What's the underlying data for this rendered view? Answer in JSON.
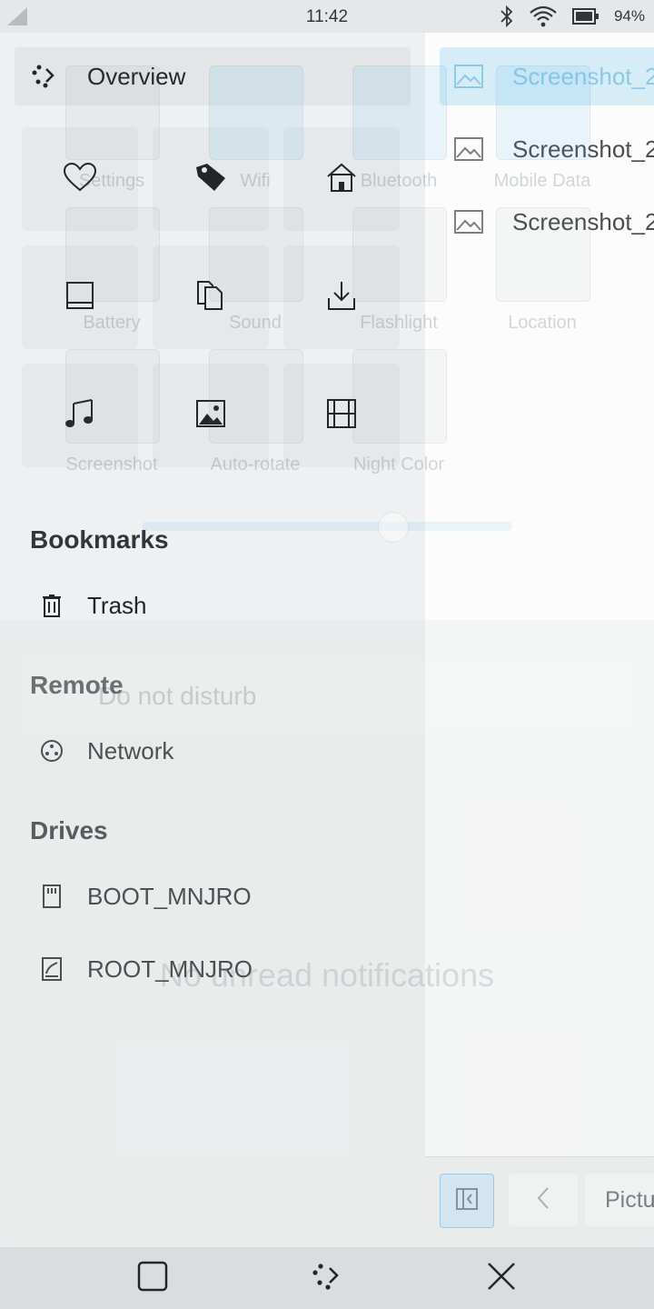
{
  "status_bar": {
    "time": "11:42",
    "battery_percent": "94%"
  },
  "places": {
    "overview": {
      "label": "Overview",
      "icon": "overview-icon"
    },
    "quick_grid": [
      {
        "name": "favorites-icon"
      },
      {
        "name": "tag-icon"
      },
      {
        "name": "home-icon"
      },
      {
        "name": "desktop-icon"
      },
      {
        "name": "documents-icon"
      },
      {
        "name": "downloads-icon"
      },
      {
        "name": "music-icon"
      },
      {
        "name": "pictures-icon"
      },
      {
        "name": "videos-icon"
      }
    ],
    "sections": {
      "bookmarks": {
        "title": "Bookmarks",
        "items": [
          {
            "label": "Trash",
            "icon": "trash-icon"
          }
        ]
      },
      "remote": {
        "title": "Remote",
        "items": [
          {
            "label": "Network",
            "icon": "network-icon"
          }
        ]
      },
      "drives": {
        "title": "Drives",
        "items": [
          {
            "label": "BOOT_MNJRO",
            "icon": "sd-card-icon"
          },
          {
            "label": "ROOT_MNJRO",
            "icon": "drive-icon"
          }
        ]
      }
    }
  },
  "files": {
    "items": [
      {
        "name": "Screenshot_2",
        "selected": true
      },
      {
        "name": "Screenshot_2",
        "selected": false
      },
      {
        "name": "Screenshot_2",
        "selected": false
      }
    ],
    "breadcrumb": "Pictu"
  },
  "ghost_quick_settings": {
    "tiles": [
      "Settings",
      "Wifi",
      "Bluetooth",
      "Mobile Data",
      "Battery",
      "Sound",
      "Flashlight",
      "Location",
      "Screenshot",
      "Auto-rotate",
      "Night Color"
    ],
    "do_not_disturb": "Do not disturb",
    "empty_notifications": "No unread notifications"
  },
  "colors": {
    "accent": "#3daee9",
    "selection": "#d6ecf7"
  }
}
